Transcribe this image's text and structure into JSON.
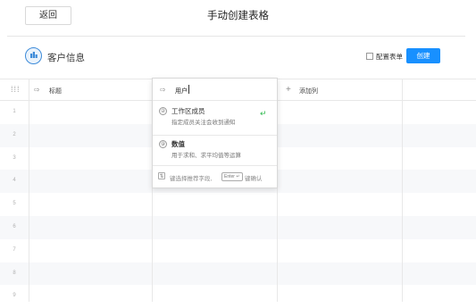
{
  "topbar": {
    "back_label": "返回",
    "title": "手动创建表格"
  },
  "form": {
    "title": "客户信息",
    "config_label": "配置表单",
    "create_label": "创建"
  },
  "table": {
    "columns": [
      {
        "label": "标题",
        "icon": "field-icon"
      },
      {
        "label": "用户",
        "icon": "field-icon"
      },
      {
        "label": "添加列",
        "icon": "plus-icon"
      }
    ],
    "row_numbers": [
      "1",
      "2",
      "3",
      "4",
      "5",
      "6",
      "7",
      "8",
      "9"
    ]
  },
  "popover": {
    "input_value": "用户",
    "options": [
      {
        "title": "工作区成员",
        "description": "指定成员关注会收到通知",
        "icon": "member-icon"
      },
      {
        "title": "数值",
        "description": "用于求和、求平均值等运算",
        "icon": "number-icon"
      }
    ],
    "footer": {
      "select_hint": "键选择推荐字段,",
      "enter_key": "Enter ↵",
      "confirm_hint": "键确认"
    }
  },
  "colors": {
    "accent": "#1890ff",
    "alt_row": "#f7f8fa",
    "enter_arrow": "#2db84d"
  }
}
